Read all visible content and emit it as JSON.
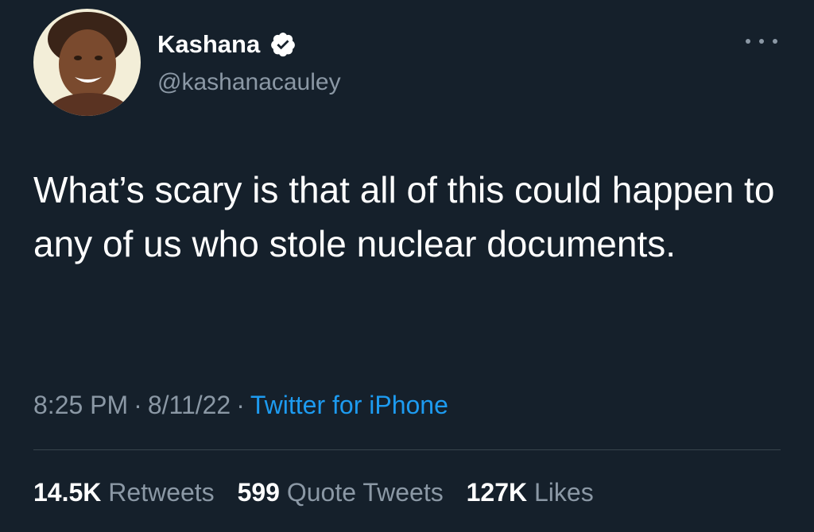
{
  "author": {
    "display_name": "Kashana",
    "handle": "@kashanacauley",
    "verified": true,
    "avatar_icon": "profile-photo"
  },
  "tweet": {
    "text": "What’s scary is that all of this could happen to any of us who stole nuclear documents.",
    "time": "8:25 PM",
    "date": "8/11/22",
    "separator": "·",
    "source": "Twitter for iPhone"
  },
  "stats": {
    "retweets_count": "14.5K",
    "retweets_label": "Retweets",
    "quotes_count": "599",
    "quotes_label": "Quote Tweets",
    "likes_count": "127K",
    "likes_label": "Likes"
  },
  "colors": {
    "background": "#15202b",
    "text_primary": "#ffffff",
    "text_secondary": "#8b98a5",
    "accent": "#1d9bf0",
    "divider": "#38444d"
  },
  "icons": {
    "verified": "verified-badge-icon",
    "more": "more-options-icon"
  }
}
